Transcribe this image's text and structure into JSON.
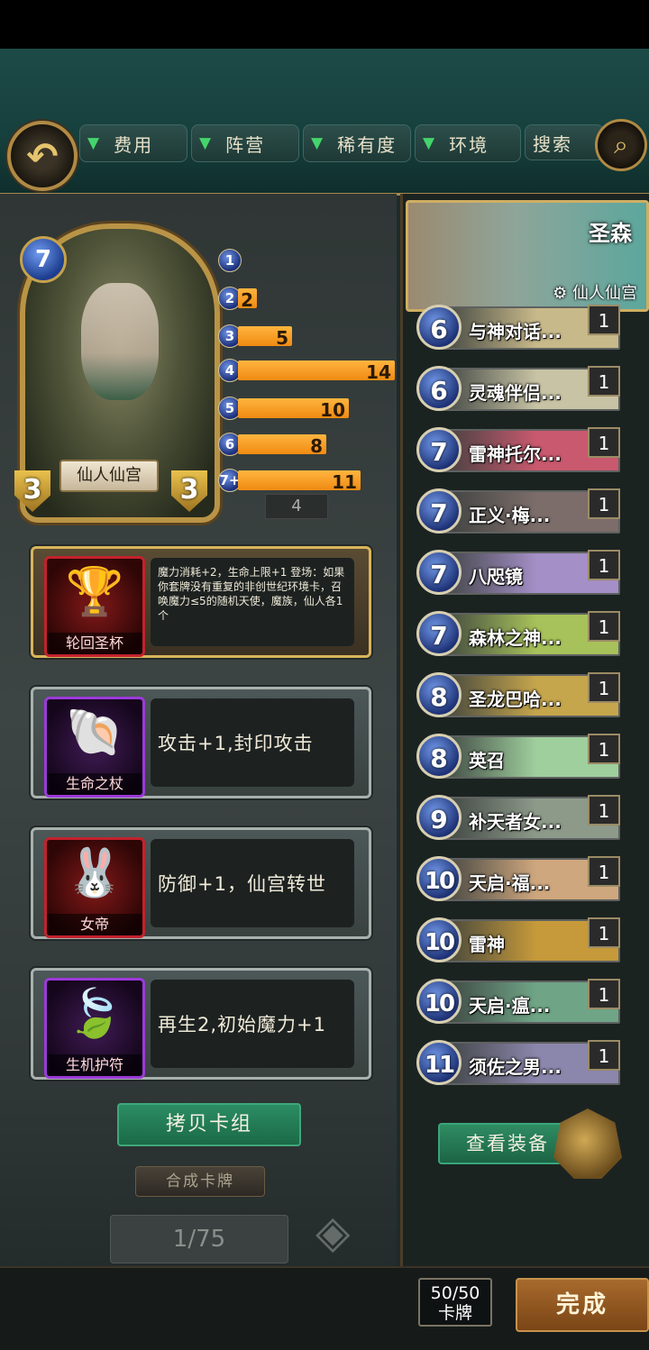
{
  "filters": [
    {
      "label": "费用"
    },
    {
      "label": "阵营"
    },
    {
      "label": "稀有度"
    },
    {
      "label": "环境"
    }
  ],
  "search_label": "搜索",
  "hero": {
    "cost": "7",
    "name": "仙人仙宫",
    "attack": "3",
    "health": "3"
  },
  "mana_curve": [
    {
      "cost": "1",
      "count": 0,
      "label": ""
    },
    {
      "cost": "2",
      "count": 2,
      "label": "2"
    },
    {
      "cost": "3",
      "count": 5,
      "label": "5"
    },
    {
      "cost": "4",
      "count": 14,
      "label": "14"
    },
    {
      "cost": "5",
      "count": 10,
      "label": "10"
    },
    {
      "cost": "6",
      "count": 8,
      "label": "8"
    },
    {
      "cost": "7+",
      "count": 11,
      "label": "11"
    }
  ],
  "bg_slots": {
    "a": "4",
    "b": "4"
  },
  "equipment": [
    {
      "name": "轮回圣杯",
      "desc": "魔力消耗+2，生命上限+1 登场：如果你套牌没有重复的非创世纪环境卡，召唤魔力≤5的随机天使，魔族，仙人各1个",
      "glyph": "🏆"
    },
    {
      "name": "生命之杖",
      "desc": "攻击+1,封印攻击",
      "glyph": "🐚"
    },
    {
      "name": "女帝",
      "desc": "防御+1，仙宫转世",
      "glyph": "🐰"
    },
    {
      "name": "生机护符",
      "desc": "再生2,初始魔力+1",
      "glyph": "🍃"
    }
  ],
  "copy_deck_label": "拷贝卡组",
  "craft_label": "合成卡牌",
  "page_indicator": "1/75",
  "deck_hero": {
    "title": "圣森",
    "subtitle": "仙人仙宫"
  },
  "cards": [
    {
      "cost": "6",
      "name": "与神对话...",
      "count": "1",
      "color": "#c8b98a"
    },
    {
      "cost": "6",
      "name": "灵魂伴侣...",
      "count": "1",
      "color": "#c7c3a4"
    },
    {
      "cost": "7",
      "name": "雷神托尔...",
      "count": "1",
      "color": "#c9596e"
    },
    {
      "cost": "7",
      "name": "正义·梅...",
      "count": "1",
      "color": "#7c6d6a"
    },
    {
      "cost": "7",
      "name": "八咫镜",
      "count": "1",
      "color": "#a48fc7"
    },
    {
      "cost": "7",
      "name": "森林之神...",
      "count": "1",
      "color": "#a7c25a"
    },
    {
      "cost": "8",
      "name": "圣龙巴哈...",
      "count": "1",
      "color": "#c6a64c"
    },
    {
      "cost": "8",
      "name": "英召",
      "count": "1",
      "color": "#9fcf9d"
    },
    {
      "cost": "9",
      "name": "补天者女...",
      "count": "1",
      "color": "#8d9a8a"
    },
    {
      "cost": "10",
      "name": "天启·福...",
      "count": "1",
      "color": "#cfa77e"
    },
    {
      "cost": "10",
      "name": "雷神",
      "count": "1",
      "color": "#c69a3a"
    },
    {
      "cost": "10",
      "name": "天启·瘟...",
      "count": "1",
      "color": "#6fa586"
    },
    {
      "cost": "11",
      "name": "须佐之男...",
      "count": "1",
      "color": "#8b86ac"
    }
  ],
  "view_equipment_label": "查看装备",
  "deck_count": {
    "value": "50/50",
    "unit": "卡牌"
  },
  "done_label": "完成",
  "colors": {
    "accent_green": "#44d46b",
    "gold": "#b08a44",
    "bar_orange": "#f5a125"
  }
}
